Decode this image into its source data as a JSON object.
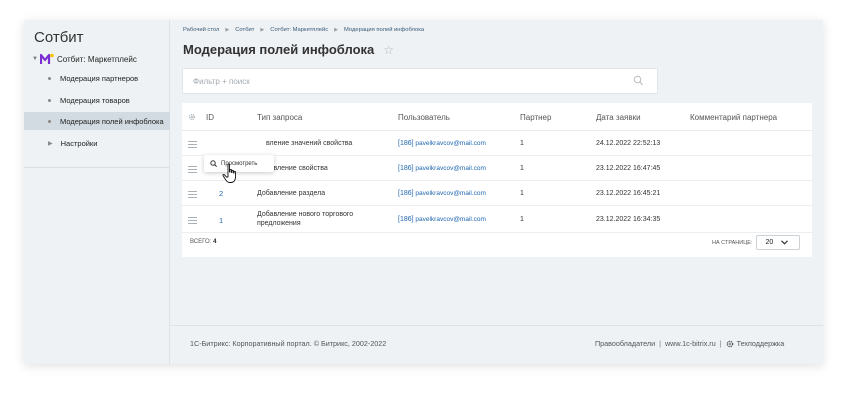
{
  "sidebar": {
    "title": "Сотбит",
    "module_label": "Сотбит: Маркетплейс",
    "items": [
      {
        "label": "Модерация партнеров"
      },
      {
        "label": "Модерация товаров"
      },
      {
        "label": "Модерация полей инфоблока"
      },
      {
        "label": "Настройки"
      }
    ]
  },
  "breadcrumb": [
    "Рабочий стол",
    "Сотбит",
    "Сотбит: Маркетплейс",
    "Модерация полей инфоблока"
  ],
  "page_title": "Модерация полей инфоблока",
  "filter": {
    "placeholder": "Фильтр + поиск"
  },
  "table": {
    "headers": [
      "ID",
      "Тип запроса",
      "Пользователь",
      "Партнер",
      "Дата заявки",
      "Комментарий партнера"
    ],
    "rows": [
      {
        "id": "",
        "type": "вление значений свойства",
        "user_num": "[186]",
        "user_email": "pavelkravcov@mail.com",
        "partner": "1",
        "date": "24.12.2022 22:52:13",
        "comment": ""
      },
      {
        "id": "3",
        "type": "Добавление свойства",
        "user_num": "[186]",
        "user_email": "pavelkravcov@mail.com",
        "partner": "1",
        "date": "23.12.2022 16:47:45",
        "comment": ""
      },
      {
        "id": "2",
        "type": "Добавление раздела",
        "user_num": "[186]",
        "user_email": "pavelkravcov@mail.com",
        "partner": "1",
        "date": "23.12.2022 16:45:21",
        "comment": ""
      },
      {
        "id": "1",
        "type_line1": "Добавление нового торгового",
        "type_line2": "предложения",
        "user_num": "[186]",
        "user_email": "pavelkravcov@mail.com",
        "partner": "1",
        "date": "23.12.2022 16:34:35",
        "comment": ""
      }
    ],
    "total_label": "ВСЕГО:",
    "total_value": "4",
    "per_page_label": "НА СТРАНИЦЕ:",
    "per_page_value": "20"
  },
  "popup": {
    "label": "Просмотреть"
  },
  "footer": {
    "copyright": "1С-Битрикс: Корпоративный портал. © Битрикс, 2002-2022",
    "rights": "Правообладатели",
    "site": "www.1c-bitrix.ru",
    "support": "Техподдержка"
  },
  "colors": {
    "accent": "#2067b0",
    "logo_purple": "#7b2fd0",
    "logo_yellow": "#f5c400"
  }
}
